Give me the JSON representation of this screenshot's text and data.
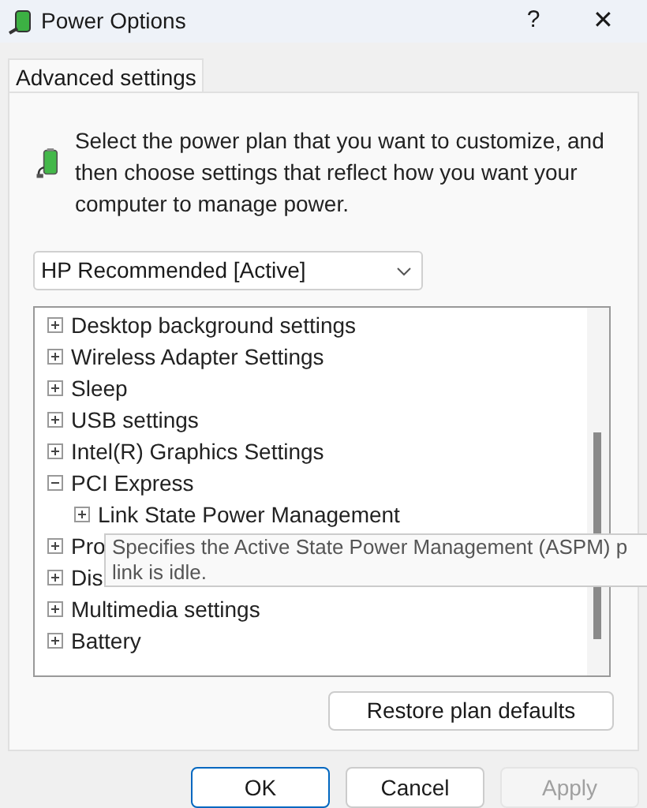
{
  "window": {
    "title": "Power Options",
    "help": "?",
    "close": "✕"
  },
  "tabs": [
    {
      "label": "Advanced settings",
      "selected": true
    }
  ],
  "intro": "Select the power plan that you want to customize, and then choose settings that reflect how you want your computer to manage power.",
  "plan_dropdown": {
    "value": "HP Recommended [Active]"
  },
  "tree": {
    "items": [
      {
        "label": "Desktop background settings",
        "expanded": false
      },
      {
        "label": "Wireless Adapter Settings",
        "expanded": false
      },
      {
        "label": "Sleep",
        "expanded": false
      },
      {
        "label": "USB settings",
        "expanded": false
      },
      {
        "label": "Intel(R) Graphics Settings",
        "expanded": false
      },
      {
        "label": "PCI Express",
        "expanded": true,
        "children": [
          {
            "label": "Link State Power Management",
            "expanded": false
          }
        ]
      },
      {
        "label": "Pro",
        "expanded": false
      },
      {
        "label": "Dis",
        "expanded": false
      },
      {
        "label": "Multimedia settings",
        "expanded": false
      },
      {
        "label": "Battery",
        "expanded": false
      }
    ]
  },
  "tooltip": [
    "Specifies the Active State Power Management (ASPM) p",
    "link is idle."
  ],
  "restore_button": "Restore plan defaults",
  "buttons": [
    {
      "label": "OK",
      "disabled": false,
      "default": true
    },
    {
      "label": "Cancel",
      "disabled": false,
      "default": false
    },
    {
      "label": "Apply",
      "disabled": true,
      "default": false
    }
  ]
}
